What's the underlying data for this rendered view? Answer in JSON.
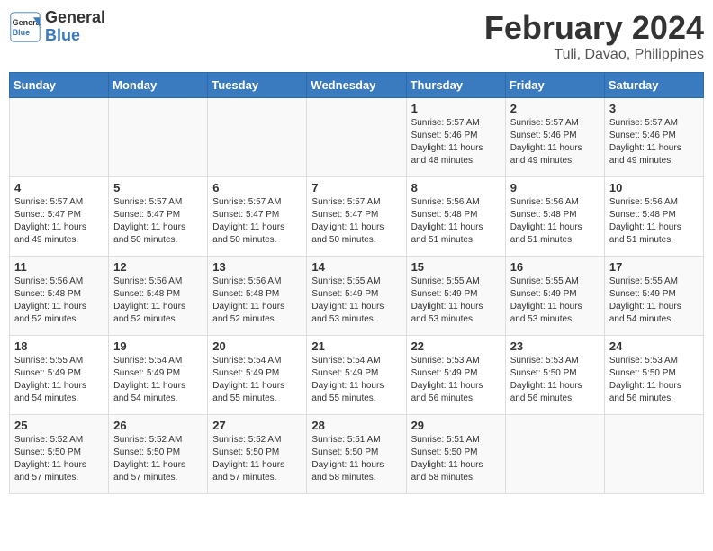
{
  "header": {
    "logo_line1": "General",
    "logo_line2": "Blue",
    "title": "February 2024",
    "subtitle": "Tuli, Davao, Philippines"
  },
  "days_of_week": [
    "Sunday",
    "Monday",
    "Tuesday",
    "Wednesday",
    "Thursday",
    "Friday",
    "Saturday"
  ],
  "weeks": [
    [
      {
        "day": "",
        "info": ""
      },
      {
        "day": "",
        "info": ""
      },
      {
        "day": "",
        "info": ""
      },
      {
        "day": "",
        "info": ""
      },
      {
        "day": "1",
        "info": "Sunrise: 5:57 AM\nSunset: 5:46 PM\nDaylight: 11 hours\nand 48 minutes."
      },
      {
        "day": "2",
        "info": "Sunrise: 5:57 AM\nSunset: 5:46 PM\nDaylight: 11 hours\nand 49 minutes."
      },
      {
        "day": "3",
        "info": "Sunrise: 5:57 AM\nSunset: 5:46 PM\nDaylight: 11 hours\nand 49 minutes."
      }
    ],
    [
      {
        "day": "4",
        "info": "Sunrise: 5:57 AM\nSunset: 5:47 PM\nDaylight: 11 hours\nand 49 minutes."
      },
      {
        "day": "5",
        "info": "Sunrise: 5:57 AM\nSunset: 5:47 PM\nDaylight: 11 hours\nand 50 minutes."
      },
      {
        "day": "6",
        "info": "Sunrise: 5:57 AM\nSunset: 5:47 PM\nDaylight: 11 hours\nand 50 minutes."
      },
      {
        "day": "7",
        "info": "Sunrise: 5:57 AM\nSunset: 5:47 PM\nDaylight: 11 hours\nand 50 minutes."
      },
      {
        "day": "8",
        "info": "Sunrise: 5:56 AM\nSunset: 5:48 PM\nDaylight: 11 hours\nand 51 minutes."
      },
      {
        "day": "9",
        "info": "Sunrise: 5:56 AM\nSunset: 5:48 PM\nDaylight: 11 hours\nand 51 minutes."
      },
      {
        "day": "10",
        "info": "Sunrise: 5:56 AM\nSunset: 5:48 PM\nDaylight: 11 hours\nand 51 minutes."
      }
    ],
    [
      {
        "day": "11",
        "info": "Sunrise: 5:56 AM\nSunset: 5:48 PM\nDaylight: 11 hours\nand 52 minutes."
      },
      {
        "day": "12",
        "info": "Sunrise: 5:56 AM\nSunset: 5:48 PM\nDaylight: 11 hours\nand 52 minutes."
      },
      {
        "day": "13",
        "info": "Sunrise: 5:56 AM\nSunset: 5:48 PM\nDaylight: 11 hours\nand 52 minutes."
      },
      {
        "day": "14",
        "info": "Sunrise: 5:55 AM\nSunset: 5:49 PM\nDaylight: 11 hours\nand 53 minutes."
      },
      {
        "day": "15",
        "info": "Sunrise: 5:55 AM\nSunset: 5:49 PM\nDaylight: 11 hours\nand 53 minutes."
      },
      {
        "day": "16",
        "info": "Sunrise: 5:55 AM\nSunset: 5:49 PM\nDaylight: 11 hours\nand 53 minutes."
      },
      {
        "day": "17",
        "info": "Sunrise: 5:55 AM\nSunset: 5:49 PM\nDaylight: 11 hours\nand 54 minutes."
      }
    ],
    [
      {
        "day": "18",
        "info": "Sunrise: 5:55 AM\nSunset: 5:49 PM\nDaylight: 11 hours\nand 54 minutes."
      },
      {
        "day": "19",
        "info": "Sunrise: 5:54 AM\nSunset: 5:49 PM\nDaylight: 11 hours\nand 54 minutes."
      },
      {
        "day": "20",
        "info": "Sunrise: 5:54 AM\nSunset: 5:49 PM\nDaylight: 11 hours\nand 55 minutes."
      },
      {
        "day": "21",
        "info": "Sunrise: 5:54 AM\nSunset: 5:49 PM\nDaylight: 11 hours\nand 55 minutes."
      },
      {
        "day": "22",
        "info": "Sunrise: 5:53 AM\nSunset: 5:49 PM\nDaylight: 11 hours\nand 56 minutes."
      },
      {
        "day": "23",
        "info": "Sunrise: 5:53 AM\nSunset: 5:50 PM\nDaylight: 11 hours\nand 56 minutes."
      },
      {
        "day": "24",
        "info": "Sunrise: 5:53 AM\nSunset: 5:50 PM\nDaylight: 11 hours\nand 56 minutes."
      }
    ],
    [
      {
        "day": "25",
        "info": "Sunrise: 5:52 AM\nSunset: 5:50 PM\nDaylight: 11 hours\nand 57 minutes."
      },
      {
        "day": "26",
        "info": "Sunrise: 5:52 AM\nSunset: 5:50 PM\nDaylight: 11 hours\nand 57 minutes."
      },
      {
        "day": "27",
        "info": "Sunrise: 5:52 AM\nSunset: 5:50 PM\nDaylight: 11 hours\nand 57 minutes."
      },
      {
        "day": "28",
        "info": "Sunrise: 5:51 AM\nSunset: 5:50 PM\nDaylight: 11 hours\nand 58 minutes."
      },
      {
        "day": "29",
        "info": "Sunrise: 5:51 AM\nSunset: 5:50 PM\nDaylight: 11 hours\nand 58 minutes."
      },
      {
        "day": "",
        "info": ""
      },
      {
        "day": "",
        "info": ""
      }
    ]
  ]
}
